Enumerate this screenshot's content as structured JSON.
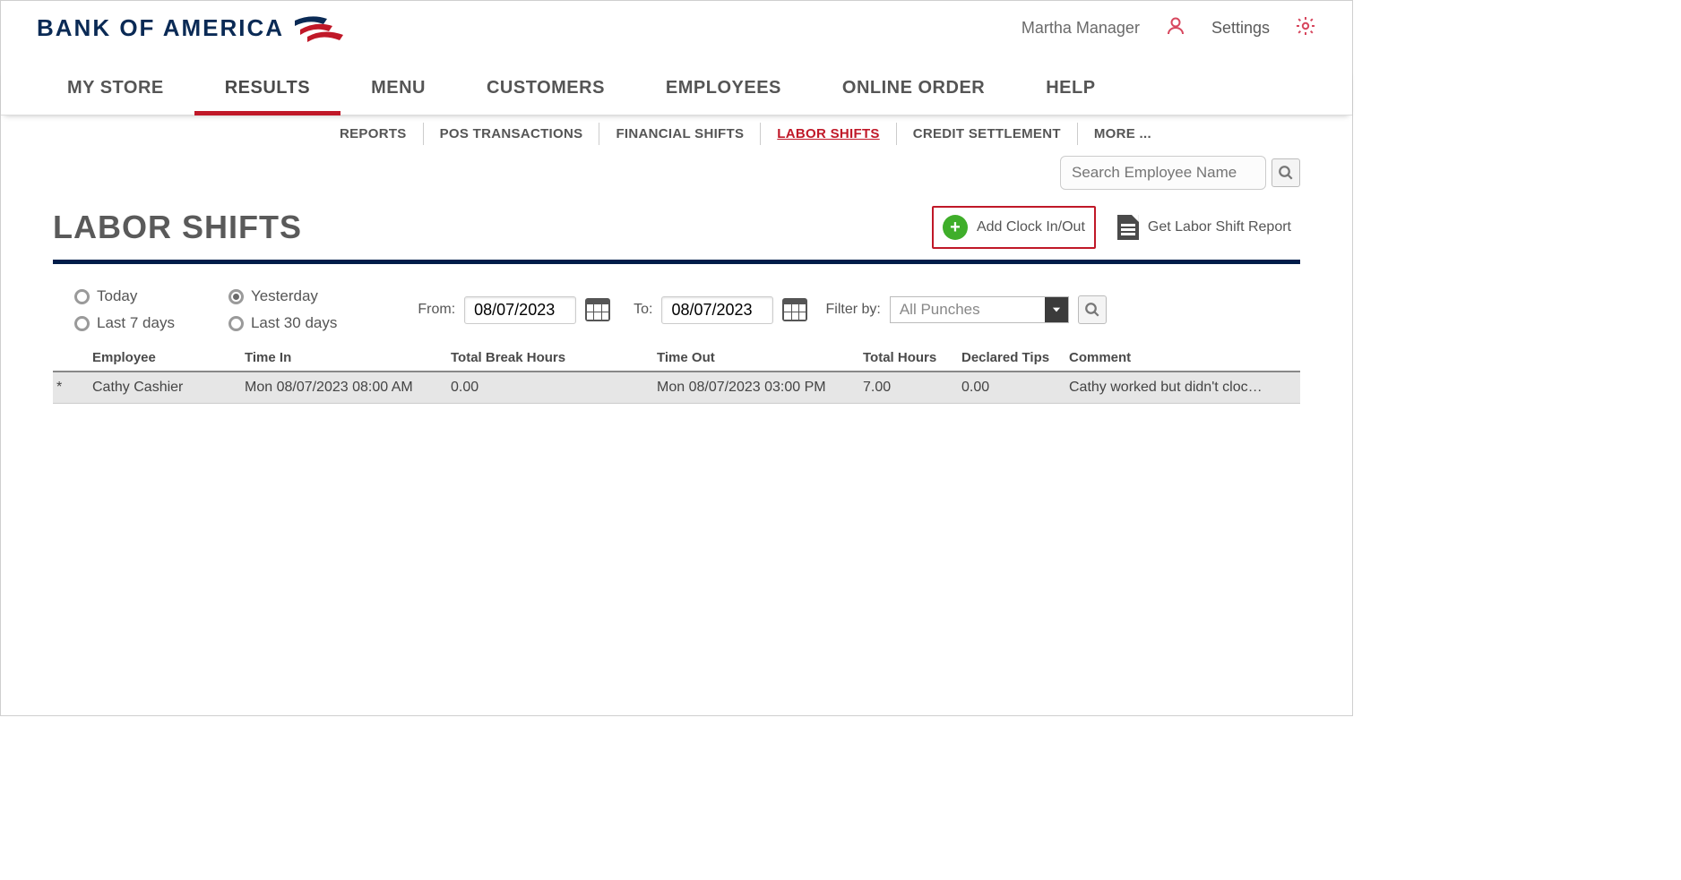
{
  "brand": {
    "name": "BANK OF AMERICA"
  },
  "header": {
    "user_name": "Martha Manager",
    "settings_label": "Settings"
  },
  "mainnav": {
    "items": [
      "MY STORE",
      "RESULTS",
      "MENU",
      "CUSTOMERS",
      "EMPLOYEES",
      "ONLINE ORDER",
      "HELP"
    ],
    "active_index": 1
  },
  "subnav": {
    "items": [
      "REPORTS",
      "POS TRANSACTIONS",
      "FINANCIAL SHIFTS",
      "LABOR SHIFTS",
      "CREDIT SETTLEMENT",
      "MORE ..."
    ],
    "active_index": 3
  },
  "search": {
    "placeholder": "Search Employee Name"
  },
  "page": {
    "title": "LABOR SHIFTS"
  },
  "actions": {
    "add_clock_label": "Add Clock In/Out",
    "report_label": "Get Labor Shift Report"
  },
  "filters": {
    "radios": [
      "Today",
      "Yesterday",
      "Last 7 days",
      "Last 30 days"
    ],
    "selected_radio_index": 1,
    "from_label": "From:",
    "to_label": "To:",
    "from_value": "08/07/2023",
    "to_value": "08/07/2023",
    "filterby_label": "Filter by:",
    "filterby_value": "All Punches"
  },
  "table": {
    "columns": [
      "",
      "Employee",
      "Time In",
      "Total Break Hours",
      "Time Out",
      "Total Hours",
      "Declared Tips",
      "Comment"
    ],
    "rows": [
      {
        "marker": "*",
        "employee": "Cathy Cashier",
        "time_in": "Mon 08/07/2023 08:00 AM",
        "break_hours": "0.00",
        "time_out": "Mon 08/07/2023 03:00 PM",
        "total_hours": "7.00",
        "declared_tips": "0.00",
        "comment": "Cathy worked but didn't cloc…"
      }
    ]
  }
}
